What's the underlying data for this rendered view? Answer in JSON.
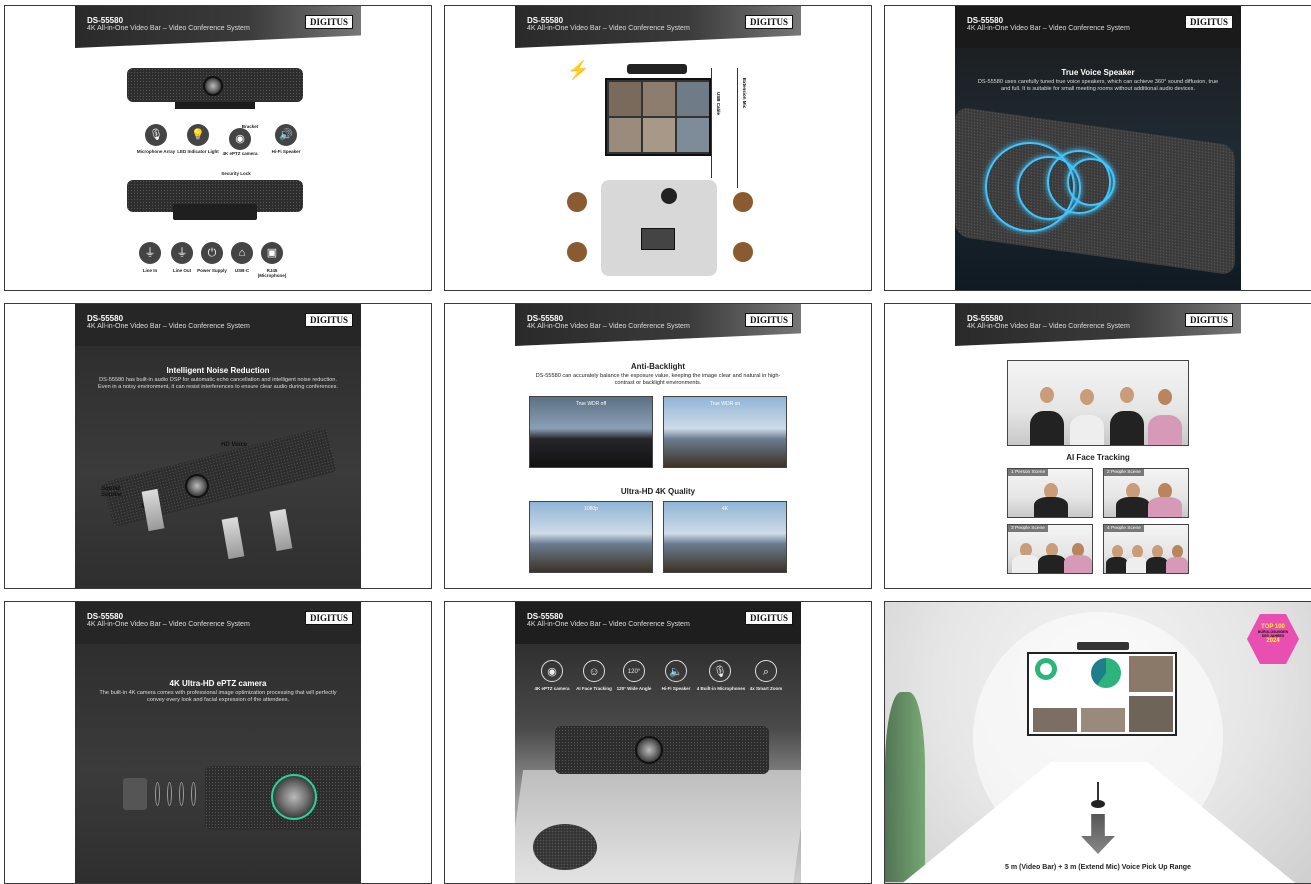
{
  "common": {
    "model": "DS-55580",
    "subtitle": "4K All-in-One Video Bar – Video Conference System",
    "brand": "DIGITUS"
  },
  "panel1": {
    "labels_top": [
      "Microphone Array",
      "LED Indicator Light",
      "4K ePTZ camera",
      "Bracket",
      "Hi-Fi Speaker"
    ],
    "security_lock": "Security Lock",
    "labels_bottom": [
      "Line In",
      "Line Out",
      "Power Supply",
      "USB-C",
      "RJ45\n(Microphone)"
    ]
  },
  "panel2": {
    "usb_cable": "USB Cable",
    "extension_mic": "Extension Mic"
  },
  "panel3": {
    "title": "True Voice Speaker",
    "text": "DS-55580 uses carefully tuned true voice speakers, which can achieve 360° sound diffusion, true and full. It is suitable for small meeting rooms without additional audio devices."
  },
  "panel4": {
    "title": "Intelligent Noise Reduction",
    "text": "DS-55580 has built-in audio DSP for automatic echo cancellation and intelligent noise reduction. Even in a noisy environment, it can resist interferences to ensure clear audio during conferences.",
    "hd_voice": "HD Voice",
    "sound_source": "Sound Source",
    "noise": "Noise"
  },
  "panel5": {
    "title1": "Anti-Backlight",
    "text1": "DS-55580 can accurately balance the exposure value, keeping the image clear and natural in high-contrast or backlight environments.",
    "wdr_off": "True WDR off",
    "wdr_on": "True WDR on",
    "title2": "Ultra-HD 4K Quality",
    "q1": "1080p",
    "q2": "4K"
  },
  "panel6": {
    "title": "AI Face Tracking",
    "scenes": [
      "1 Person Scene",
      "2 People Scene",
      "3 People Scene",
      "4 People Scene"
    ]
  },
  "panel7": {
    "title": "4K Ultra-HD ePTZ camera",
    "text": "The built-in 4K camera comes with professional image optimization processing that will perfectly convey every look and facial expression of the attendees."
  },
  "panel8": {
    "features": [
      "4K ePTZ camera",
      "AI Face Tracking",
      "120° Wide Angle",
      "Hi-Fi Speaker",
      "4 Built-in Microphones",
      "4x Smart Zoom"
    ]
  },
  "panel9": {
    "badge": [
      "TOP 100",
      "BÜROLÖSUNGEN",
      "DES JAHRES",
      "2024"
    ],
    "caption": "5 m (Video Bar) + 3 m (Extend Mic) Voice Pick Up Range"
  },
  "colors": {
    "accent_blue": "#3fc5ff",
    "badge_pink": "#e94fb0",
    "banner_dark": "#2a2a2a"
  }
}
